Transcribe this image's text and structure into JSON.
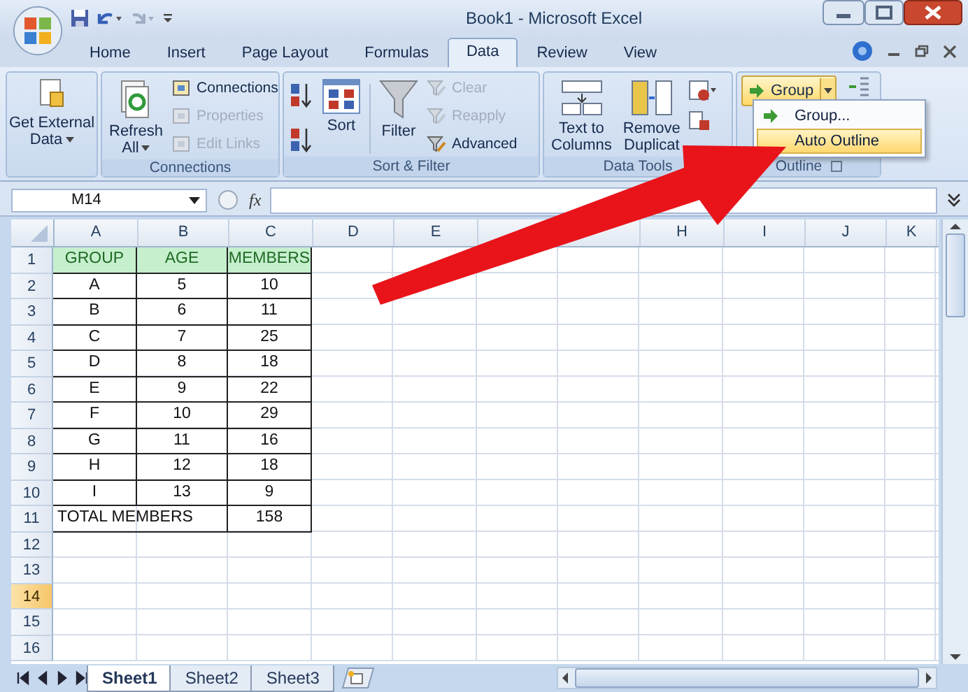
{
  "window": {
    "title": "Book1 - Microsoft Excel"
  },
  "tabs": [
    {
      "label": "Home",
      "selected": false
    },
    {
      "label": "Insert",
      "selected": false
    },
    {
      "label": "Page Layout",
      "selected": false
    },
    {
      "label": "Formulas",
      "selected": false
    },
    {
      "label": "Data",
      "selected": true
    },
    {
      "label": "Review",
      "selected": false
    },
    {
      "label": "View",
      "selected": false
    }
  ],
  "ribbon": {
    "get_external_data": {
      "lines": [
        "Get External",
        "Data"
      ]
    },
    "connections": {
      "label": "Connections",
      "refresh": {
        "lines": [
          "Refresh",
          "All"
        ]
      },
      "items": [
        {
          "label": "Connections",
          "disabled": false
        },
        {
          "label": "Properties",
          "disabled": true
        },
        {
          "label": "Edit Links",
          "disabled": true
        }
      ]
    },
    "sort_filter": {
      "label": "Sort & Filter",
      "sort": "Sort",
      "filter": "Filter",
      "items": [
        {
          "label": "Clear",
          "disabled": true
        },
        {
          "label": "Reapply",
          "disabled": true
        },
        {
          "label": "Advanced",
          "disabled": false
        }
      ]
    },
    "data_tools": {
      "label": "Data Tools",
      "items": [
        {
          "lines": [
            "Text to",
            "Columns"
          ]
        },
        {
          "lines": [
            "Remove",
            "Duplicat"
          ]
        }
      ]
    },
    "outline": {
      "label": "Outline",
      "group_button": "Group",
      "menu": [
        {
          "label": "Group...",
          "selected": false
        },
        {
          "label": "Auto Outline",
          "selected": true
        }
      ]
    }
  },
  "formula_bar": {
    "name_box": "M14",
    "function_label": "fx"
  },
  "grid": {
    "columns": [
      "A",
      "B",
      "C",
      "D",
      "E",
      null,
      null,
      "H",
      "I",
      "J",
      "K"
    ],
    "rows": [
      {
        "label": "1",
        "selected": false,
        "cells": [
          {
            "text": "GROUP",
            "kind": "header"
          },
          {
            "text": "AGE",
            "kind": "header"
          },
          {
            "text": "MEMBERS",
            "kind": "header"
          }
        ]
      },
      {
        "label": "2",
        "selected": false,
        "cells": [
          {
            "text": "A",
            "kind": "data"
          },
          {
            "text": "5",
            "kind": "data"
          },
          {
            "text": "10",
            "kind": "data"
          }
        ]
      },
      {
        "label": "3",
        "selected": false,
        "cells": [
          {
            "text": "B",
            "kind": "data"
          },
          {
            "text": "6",
            "kind": "data"
          },
          {
            "text": "11",
            "kind": "data"
          }
        ]
      },
      {
        "label": "4",
        "selected": false,
        "cells": [
          {
            "text": "C",
            "kind": "data"
          },
          {
            "text": "7",
            "kind": "data"
          },
          {
            "text": "25",
            "kind": "data"
          }
        ]
      },
      {
        "label": "5",
        "selected": false,
        "cells": [
          {
            "text": "D",
            "kind": "data"
          },
          {
            "text": "8",
            "kind": "data"
          },
          {
            "text": "18",
            "kind": "data"
          }
        ]
      },
      {
        "label": "6",
        "selected": false,
        "cells": [
          {
            "text": "E",
            "kind": "data"
          },
          {
            "text": "9",
            "kind": "data"
          },
          {
            "text": "22",
            "kind": "data"
          }
        ]
      },
      {
        "label": "7",
        "selected": false,
        "cells": [
          {
            "text": "F",
            "kind": "data"
          },
          {
            "text": "10",
            "kind": "data"
          },
          {
            "text": "29",
            "kind": "data"
          }
        ]
      },
      {
        "label": "8",
        "selected": false,
        "cells": [
          {
            "text": "G",
            "kind": "data"
          },
          {
            "text": "11",
            "kind": "data"
          },
          {
            "text": "16",
            "kind": "data"
          }
        ]
      },
      {
        "label": "9",
        "selected": false,
        "cells": [
          {
            "text": "H",
            "kind": "data"
          },
          {
            "text": "12",
            "kind": "data"
          },
          {
            "text": "18",
            "kind": "data"
          }
        ]
      },
      {
        "label": "10",
        "selected": false,
        "cells": [
          {
            "text": "I",
            "kind": "data"
          },
          {
            "text": "13",
            "kind": "data"
          },
          {
            "text": "9",
            "kind": "data"
          }
        ]
      },
      {
        "label": "11",
        "selected": false,
        "cells": [
          {
            "text": "TOTAL MEMBERS",
            "kind": "merged"
          },
          {
            "text": "",
            "kind": "covered"
          },
          {
            "text": "158",
            "kind": "data"
          }
        ]
      },
      {
        "label": "12",
        "selected": false,
        "cells": []
      },
      {
        "label": "13",
        "selected": false,
        "cells": []
      },
      {
        "label": "14",
        "selected": true,
        "cells": []
      },
      {
        "label": "15",
        "selected": false,
        "cells": []
      },
      {
        "label": "16",
        "selected": false,
        "cells": []
      }
    ]
  },
  "sheets": [
    {
      "label": "Sheet1",
      "selected": true
    },
    {
      "label": "Sheet2",
      "selected": false
    },
    {
      "label": "Sheet3",
      "selected": false
    }
  ]
}
